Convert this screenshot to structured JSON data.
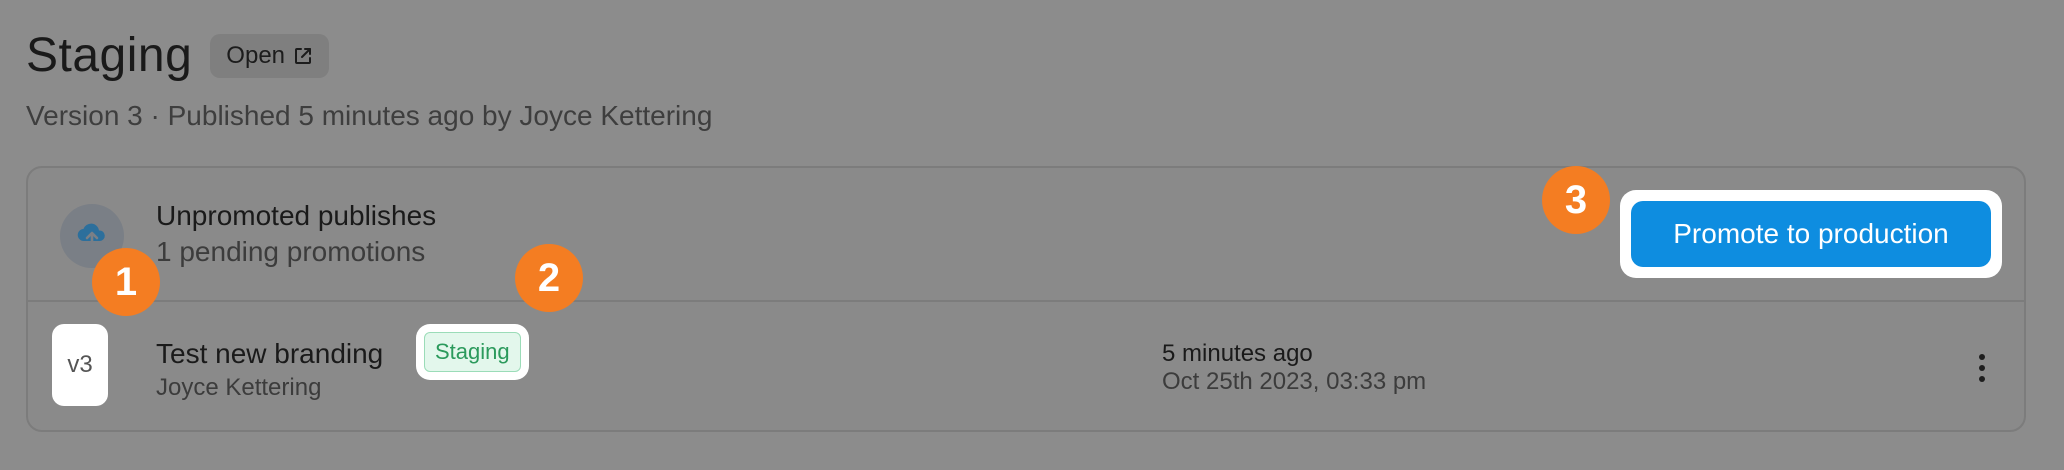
{
  "header": {
    "title": "Staging",
    "open_label": "Open",
    "open_icon": "external-link-icon",
    "subtitle": "Version 3 · Published 5 minutes ago by Joyce Kettering"
  },
  "unpromoted": {
    "icon": "cloud-upload-icon",
    "title": "Unpromoted publishes",
    "subtitle": "1 pending promotions",
    "promote_label": "Promote to production"
  },
  "versions": [
    {
      "tile": "v3",
      "title": "Test new branding",
      "badge": "Staging",
      "author": "Joyce Kettering",
      "time_relative": "5 minutes ago",
      "time_absolute": "Oct 25th 2023, 03:33 pm",
      "menu_icon": "more-vertical-icon"
    }
  ],
  "step_markers": [
    "1",
    "2",
    "3"
  ],
  "colors": {
    "background": "#8c8c8c",
    "accent": "#0e8de0",
    "marker": "#f47d22",
    "badge_text": "#2b9a5c",
    "badge_bg": "#e3f7ec"
  }
}
